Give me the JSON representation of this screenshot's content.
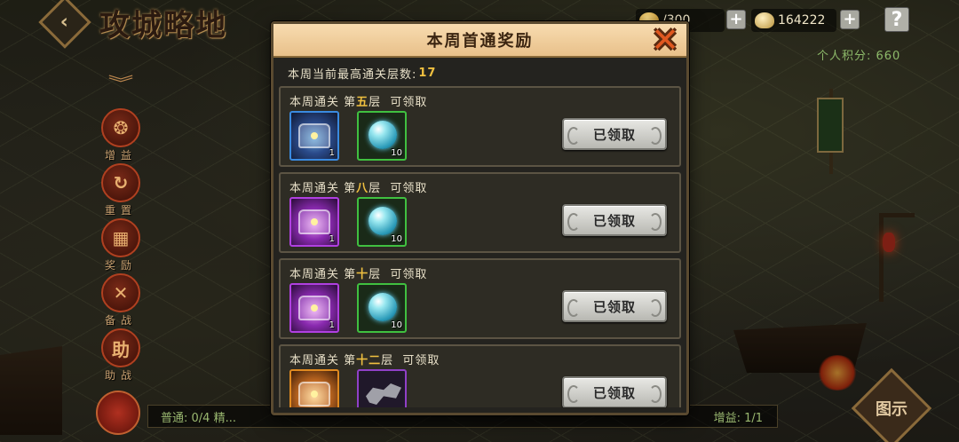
{
  "hud": {
    "title": "攻城略地",
    "resource_1": "  /300",
    "resource_2": "164222",
    "help_label": "?",
    "personal_score": "个人积分: 660"
  },
  "side_menu": [
    {
      "label": "增益",
      "glyph": "❂"
    },
    {
      "label": "重置",
      "glyph": "↻"
    },
    {
      "label": "奖励",
      "glyph": "▦"
    },
    {
      "label": "备战",
      "glyph": "✕"
    },
    {
      "label": "助战",
      "glyph": "助"
    }
  ],
  "bottom_bar": {
    "left_text": "普通: 0/4   精...",
    "right_text": "增益: 1/1"
  },
  "map_button": {
    "label": "图示"
  },
  "modal": {
    "title": "本周首通奖励",
    "max_floor_label": "本周当前最高通关层数:",
    "max_floor_value": "17",
    "rewards": [
      {
        "prefix": "本周通关 第",
        "floor": "五",
        "suffix": "层  可领取",
        "items": [
          {
            "type": "chest",
            "color": "blue",
            "qty": "1",
            "icon": "blue-chest-icon"
          },
          {
            "type": "orb",
            "color": "green",
            "qty": "10",
            "icon": "crystal-orb-icon"
          }
        ],
        "button": "已领取"
      },
      {
        "prefix": "本周通关 第",
        "floor": "八",
        "suffix": "层  可领取",
        "items": [
          {
            "type": "chest",
            "color": "purple",
            "qty": "1",
            "icon": "purple-chest-icon"
          },
          {
            "type": "orb",
            "color": "green",
            "qty": "10",
            "icon": "crystal-orb-icon"
          }
        ],
        "button": "已领取"
      },
      {
        "prefix": "本周通关 第",
        "floor": "十",
        "suffix": "层  可领取",
        "items": [
          {
            "type": "chest",
            "color": "purple",
            "qty": "1",
            "icon": "purple-chest-icon"
          },
          {
            "type": "orb",
            "color": "green",
            "qty": "10",
            "icon": "crystal-orb-icon"
          }
        ],
        "button": "已领取"
      },
      {
        "prefix": "本周通关 第",
        "floor": "十二",
        "suffix": "层  可领取",
        "items": [
          {
            "type": "chest",
            "color": "orange",
            "qty": "",
            "icon": "orange-chest-icon"
          },
          {
            "type": "beast",
            "color": "violet",
            "qty": "",
            "icon": "beast-icon"
          }
        ],
        "button": "已领取"
      }
    ]
  }
}
